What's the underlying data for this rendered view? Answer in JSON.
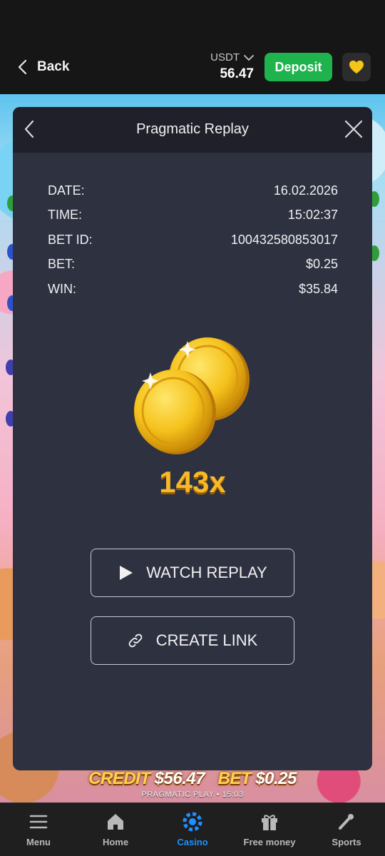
{
  "header": {
    "back_label": "Back",
    "currency": "USDT",
    "balance": "56.47",
    "deposit_label": "Deposit",
    "favorite_icon": "heart-icon"
  },
  "colors": {
    "deposit_bg": "#1fb34e",
    "modal_bg": "#2e3140",
    "multiplier": "#f7b928",
    "nav_active": "#1e90ff",
    "heart": "#f5c518"
  },
  "modal": {
    "title": "Pragmatic Replay",
    "rows": [
      {
        "label": "DATE:",
        "value": "16.02.2026"
      },
      {
        "label": "TIME:",
        "value": "15:02:37"
      },
      {
        "label": "BET ID:",
        "value": "100432580853017"
      },
      {
        "label": "BET:",
        "value": "$0.25"
      },
      {
        "label": "WIN:",
        "value": "$35.84"
      }
    ],
    "multiplier": "143x",
    "watch_label": "WATCH REPLAY",
    "link_label": "CREATE LINK"
  },
  "game": {
    "credit_label": "CREDIT",
    "credit_value": "$56.47",
    "bet_label": "BET",
    "bet_value": "$0.25",
    "provider_line": "PRAGMATIC PLAY • 15:03"
  },
  "nav": [
    {
      "label": "Menu",
      "icon": "menu-icon"
    },
    {
      "label": "Home",
      "icon": "home-icon"
    },
    {
      "label": "Casino",
      "icon": "casino-icon",
      "active": true
    },
    {
      "label": "Free money",
      "icon": "gift-icon"
    },
    {
      "label": "Sports",
      "icon": "sports-icon"
    }
  ]
}
